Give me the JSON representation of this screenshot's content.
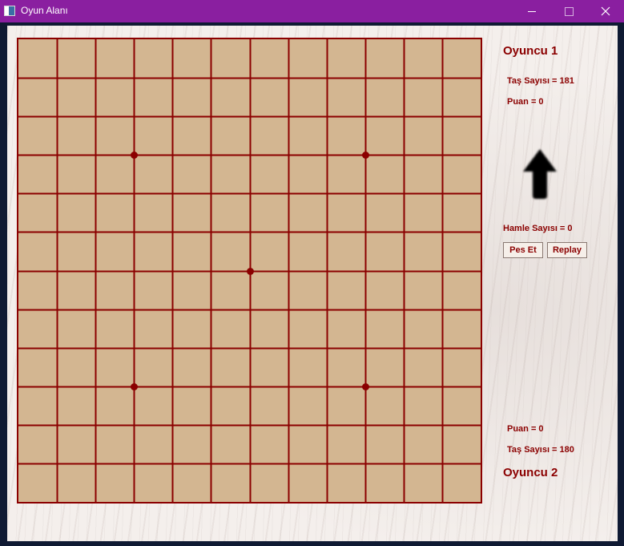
{
  "window": {
    "title": "Oyun Alanı"
  },
  "board": {
    "size": 12,
    "star_points": [
      [
        3,
        3
      ],
      [
        3,
        9
      ],
      [
        6,
        6
      ],
      [
        9,
        3
      ],
      [
        9,
        9
      ]
    ],
    "line_color": "#8b0000",
    "fill_color": "#d3b691"
  },
  "player1": {
    "name": "Oyuncu 1",
    "stones_label": "Taş Sayısı = 181",
    "score_label": "Puan = 0"
  },
  "player2": {
    "name": "Oyuncu 2",
    "stones_label": "Taş Sayısı = 180",
    "score_label": "Puan = 0"
  },
  "turn_indicator": {
    "icon": "arrow-up-icon",
    "direction": "up"
  },
  "moves_label": "Hamle Sayısı = 0",
  "buttons": {
    "resign": "Pes Et",
    "replay": "Replay"
  },
  "colors": {
    "title_bar": "#8a1fa0",
    "accent": "#8b0000"
  }
}
